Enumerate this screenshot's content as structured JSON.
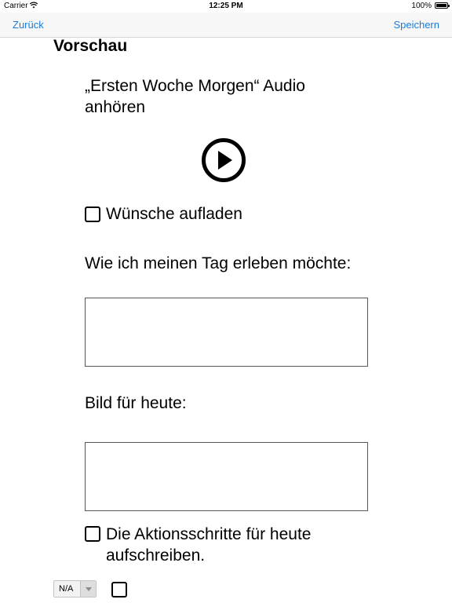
{
  "statusbar": {
    "carrier": "Carrier",
    "time": "12:25 PM",
    "battery": "100%"
  },
  "navbar": {
    "back_label": "Zurück",
    "save_label": "Speichern"
  },
  "content": {
    "section_title": "Vorschau",
    "audio_title": "„Ersten Woche Morgen“ Audio anhören",
    "wishes_label": "Wünsche aufladen",
    "day_label": "Wie ich meinen Tag erleben möchte:",
    "image_label": "Bild für heute:",
    "actions_label": "Die Aktionsschritte für heute aufschreiben.",
    "select_value": "N/A"
  },
  "icons": {
    "play": "play-circle-icon",
    "wifi": "wifi-icon",
    "battery": "battery-icon"
  },
  "colors": {
    "accent": "#1a7cd9",
    "navbar_bg": "#f7f7f7"
  }
}
